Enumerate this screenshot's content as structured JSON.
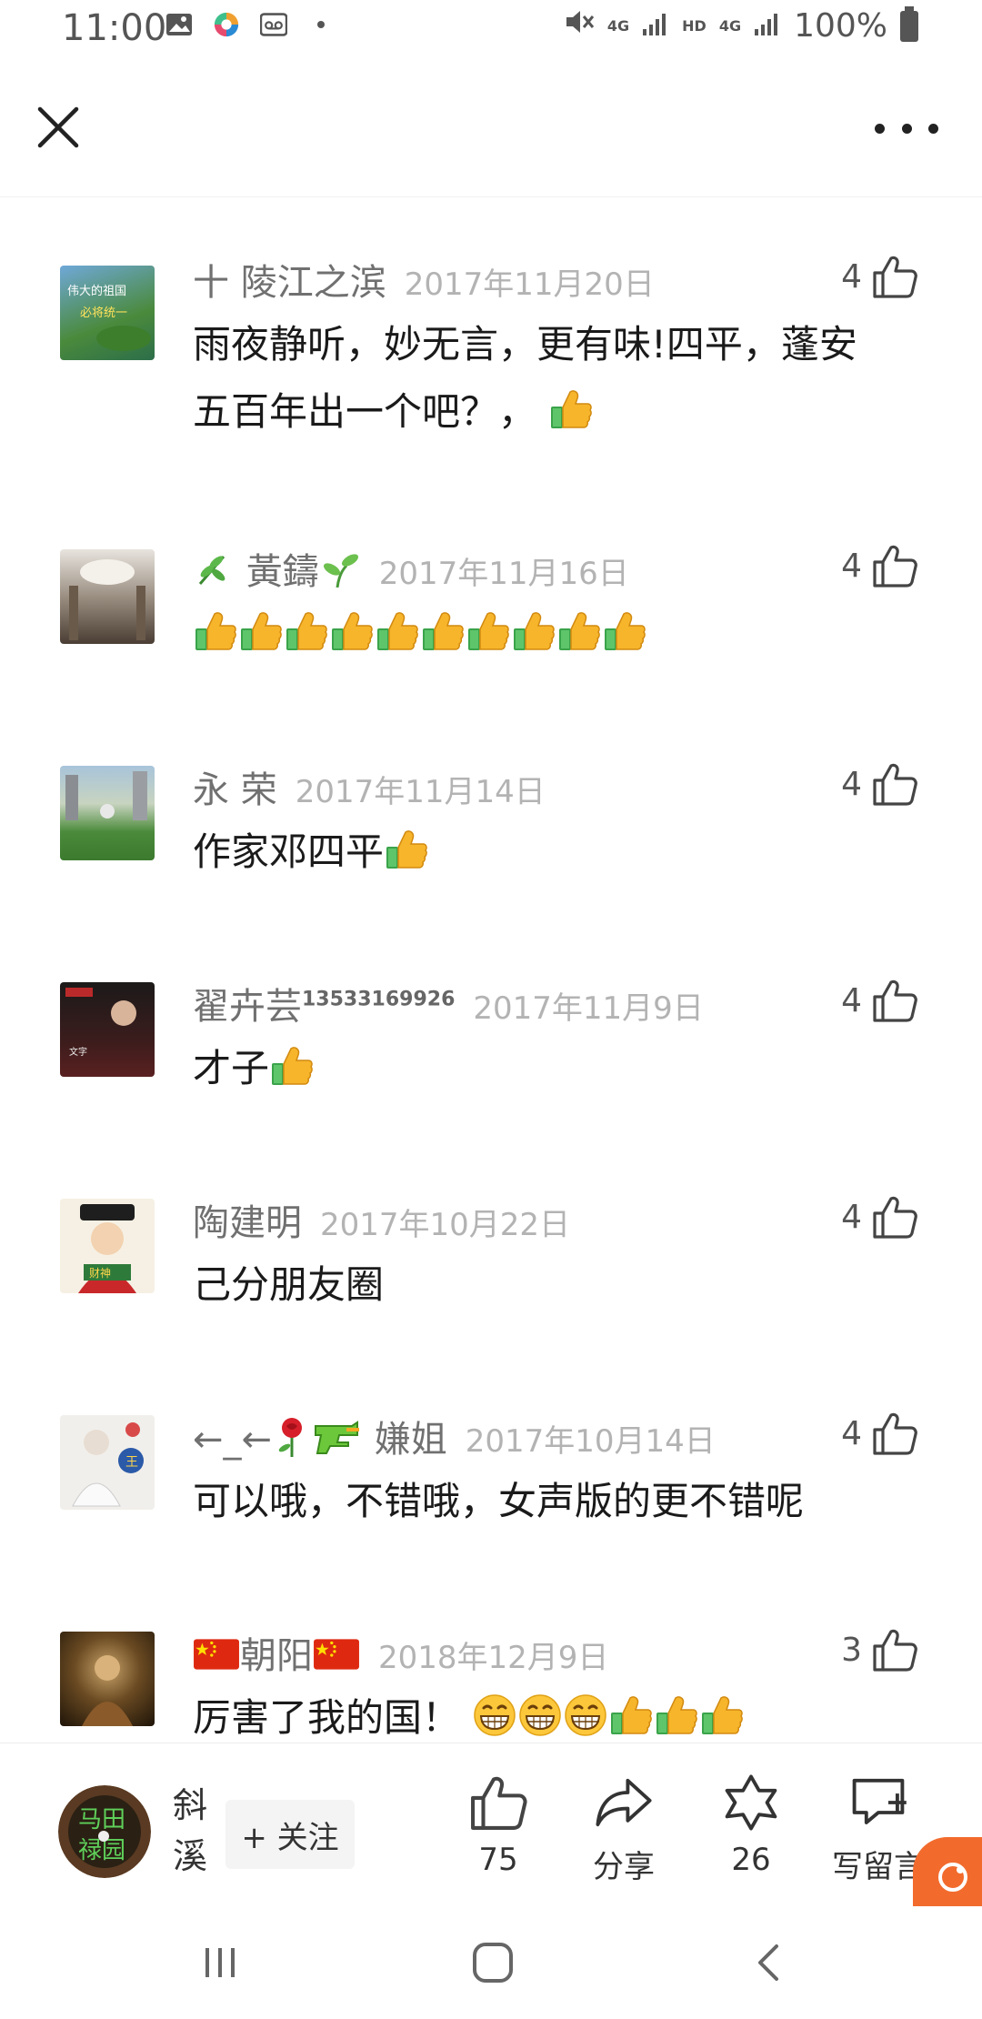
{
  "status_bar": {
    "time": "11:00",
    "network_a": "4G",
    "hd": "HD",
    "network_b": "4G",
    "battery": "100%",
    "icons": [
      "image-icon",
      "app-icon",
      "voicemail-icon",
      "dot-icon",
      "mute-icon",
      "signal-icon",
      "signal-icon",
      "battery-icon"
    ]
  },
  "top_bar": {
    "close_icon": "close-icon",
    "more_icon": "more-icon"
  },
  "comments": [
    {
      "name": "十 陵江之滨",
      "date": "2017年11月20日",
      "likes": "4",
      "text_line1": "雨夜静听，妙无言，更有味!四平，蓬安",
      "text_line2": "五百年出一个吧？，",
      "emoji_after": [
        "thumbs-up"
      ]
    },
    {
      "name": "黃鑄",
      "name_emoji_before": "herb",
      "name_emoji_after": "seedling",
      "date": "2017年11月16日",
      "likes": "4",
      "emoji_line": [
        "thumbs-up",
        "thumbs-up",
        "thumbs-up",
        "thumbs-up",
        "thumbs-up",
        "thumbs-up",
        "thumbs-up",
        "thumbs-up",
        "thumbs-up",
        "thumbs-up"
      ]
    },
    {
      "name": "永 荣",
      "date": "2017年11月14日",
      "likes": "4",
      "text": "作家邓四平",
      "emoji_after": [
        "thumbs-up"
      ]
    },
    {
      "name": "翟卉芸",
      "name_sup": "13533169926",
      "date": "2017年11月9日",
      "likes": "4",
      "text": "才子",
      "emoji_after": [
        "thumbs-up"
      ]
    },
    {
      "name": "陶建明",
      "date": "2017年10月22日",
      "likes": "4",
      "text": "己分朋友圈"
    },
    {
      "name_prefix": "←_←",
      "name": "嫌姐",
      "name_emojis": [
        "rose",
        "water-pistol"
      ],
      "date": "2017年10月14日",
      "likes": "4",
      "text": "可以哦，不错哦，女声版的更不错呢"
    },
    {
      "name": "朝阳",
      "name_emoji_before": "china-flag",
      "name_emoji_after": "china-flag",
      "date": "2018年12月9日",
      "likes": "3",
      "text": "厉害了我的国！",
      "emoji_after": [
        "grin",
        "grin",
        "grin",
        "thumbs-up",
        "thumbs-up",
        "thumbs-up"
      ]
    }
  ],
  "bottom_bar": {
    "author_name": "斜溪",
    "avatar_text": "马田 禄园",
    "follow_label": "+ 关注",
    "like_count": "75",
    "share_label": "分享",
    "star_count": "26",
    "write_label": "写留言"
  },
  "nav_bar": {
    "recent_icon": "recent-apps-icon",
    "home_icon": "home-icon",
    "back_icon": "back-icon"
  },
  "colors": {
    "accent_orange": "#f26b2d",
    "name_gray": "#707070",
    "date_gray": "#b3b3b3"
  }
}
